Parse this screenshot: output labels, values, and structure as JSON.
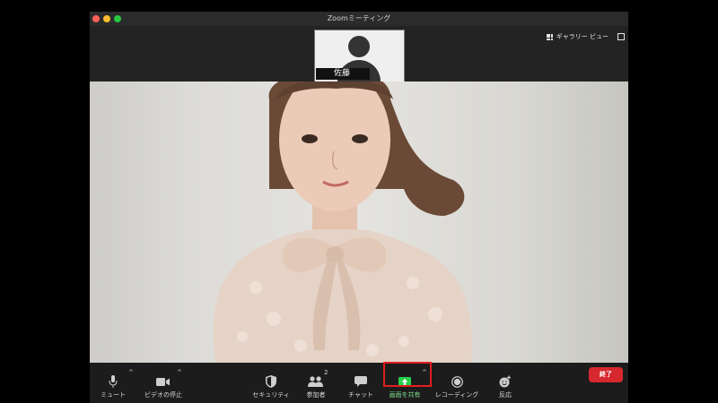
{
  "window": {
    "title": "Zoomミーティング"
  },
  "view": {
    "gallery_label": "ギャラリー ビュー"
  },
  "thumbnail": {
    "name": "佐藤"
  },
  "toolbar": {
    "mute_label": "ミュート",
    "video_label": "ビデオの停止",
    "security_label": "セキュリティ",
    "participants_label": "参加者",
    "participants_count": "2",
    "chat_label": "チャット",
    "share_label": "画面を共有",
    "record_label": "レコーディング",
    "reaction_label": "反応",
    "end_label": "終了"
  },
  "colors": {
    "share_green": "#27d04b",
    "end_red": "#d7282f",
    "highlight_red": "#e21d1d"
  }
}
